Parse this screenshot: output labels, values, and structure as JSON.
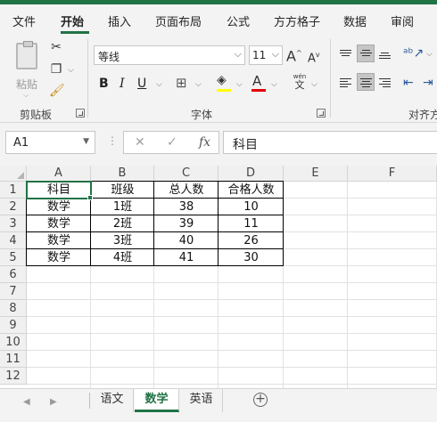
{
  "menu": {
    "tabs": [
      "文件",
      "开始",
      "插入",
      "页面布局",
      "公式",
      "方方格子",
      "数据",
      "审阅"
    ],
    "active_index": 1
  },
  "ribbon": {
    "clipboard": {
      "paste_label": "粘贴",
      "group_label": "剪贴板"
    },
    "font": {
      "font_name": "等线",
      "font_size": "11",
      "bold": "B",
      "italic": "I",
      "underline": "U",
      "grow": "A",
      "shrink": "A",
      "font_color_letter": "A",
      "phonetic_top": "wén",
      "phonetic_bottom": "文",
      "group_label": "字体",
      "highlight_color": "#ffff00",
      "font_color": "#e00000"
    },
    "alignment": {
      "group_label": "对齐方"
    }
  },
  "formula_bar": {
    "name_box": "A1",
    "cancel_icon": "✕",
    "enter_icon": "✓",
    "fx_label": "fx",
    "content": "科目"
  },
  "sheet": {
    "columns": [
      "A",
      "B",
      "C",
      "D",
      "E",
      "F"
    ],
    "rows": [
      "1",
      "2",
      "3",
      "4",
      "5",
      "6",
      "7",
      "8",
      "9",
      "10",
      "11",
      "12"
    ],
    "cells": [
      [
        "科目",
        "班级",
        "总人数",
        "合格人数"
      ],
      [
        "数学",
        "1班",
        "38",
        "10"
      ],
      [
        "数学",
        "2班",
        "39",
        "11"
      ],
      [
        "数学",
        "3班",
        "40",
        "26"
      ],
      [
        "数学",
        "4班",
        "41",
        "30"
      ]
    ]
  },
  "sheet_tabs": {
    "tabs": [
      "语文",
      "数学",
      "英语"
    ],
    "active_index": 1,
    "add_label": "+"
  },
  "colors": {
    "accent": "#217346"
  }
}
